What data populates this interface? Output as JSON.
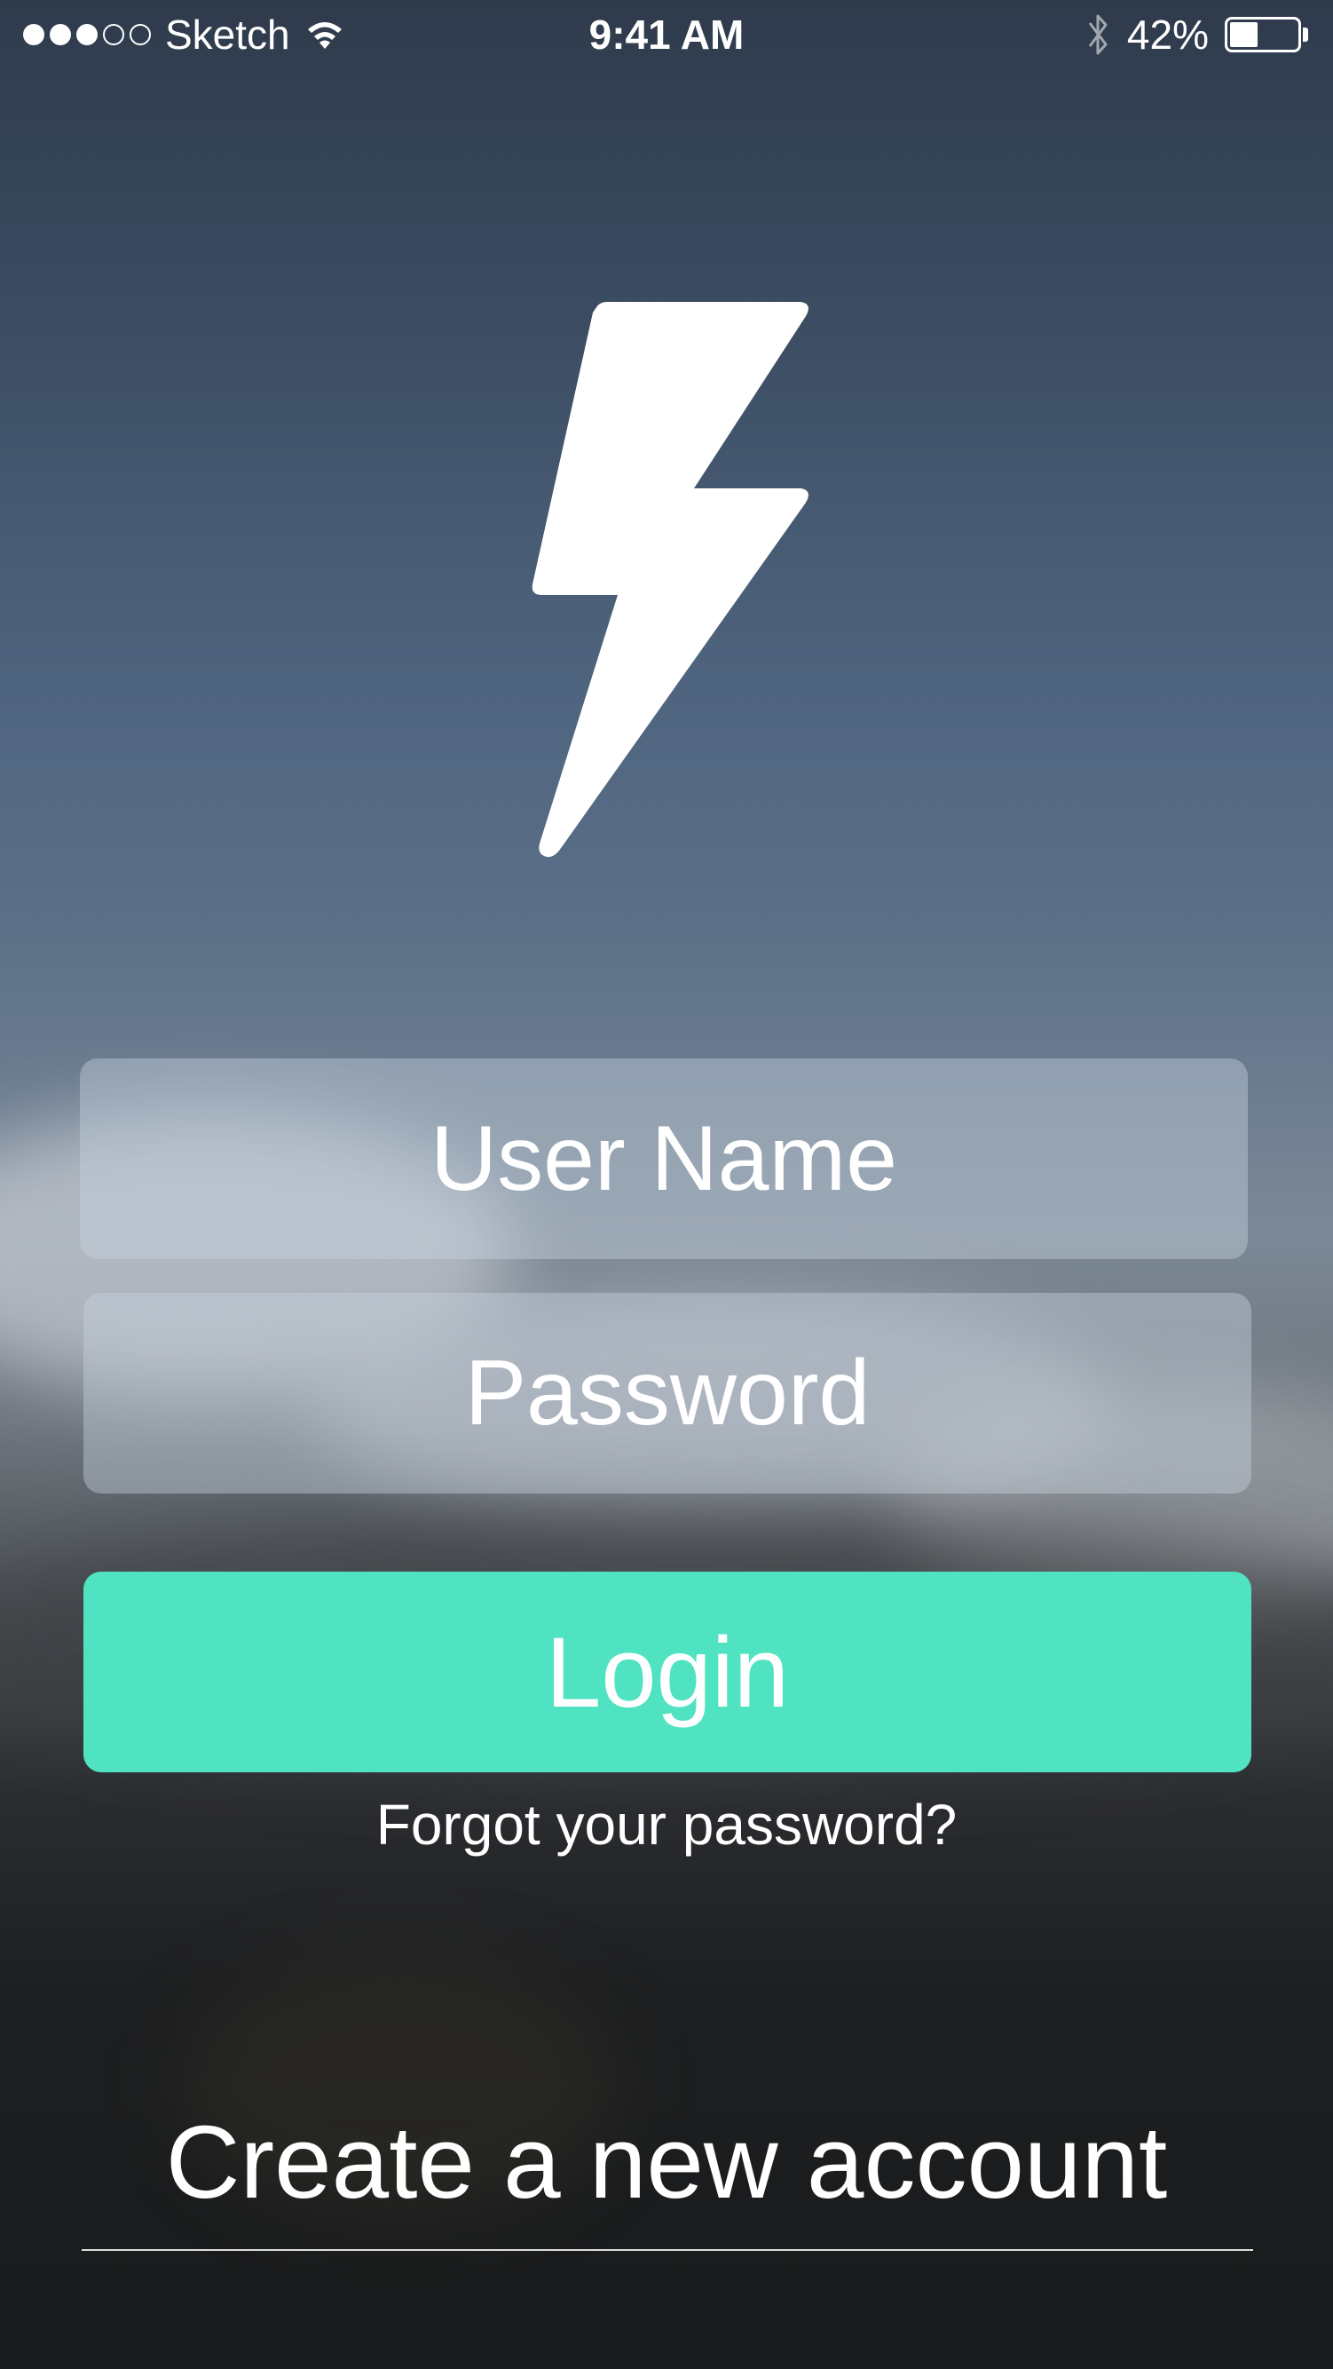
{
  "status_bar": {
    "signal": {
      "filled": 3,
      "total": 5
    },
    "carrier": "Sketch",
    "time": "9:41 AM",
    "battery_text": "42%",
    "battery_level": 0.42,
    "icons": [
      "signal-dots-icon",
      "wifi-icon",
      "bluetooth-icon",
      "battery-icon"
    ]
  },
  "logo": {
    "icon": "lightning-bolt-icon"
  },
  "form": {
    "username_placeholder": "User Name",
    "password_placeholder": "Password",
    "login_label": "Login",
    "forgot_label": "Forgot your password?"
  },
  "footer": {
    "create_account_label": "Create a new account"
  },
  "colors": {
    "accent": "#50e3c2",
    "text": "#ffffff",
    "field_bg": "rgba(200,212,225,0.42)"
  }
}
